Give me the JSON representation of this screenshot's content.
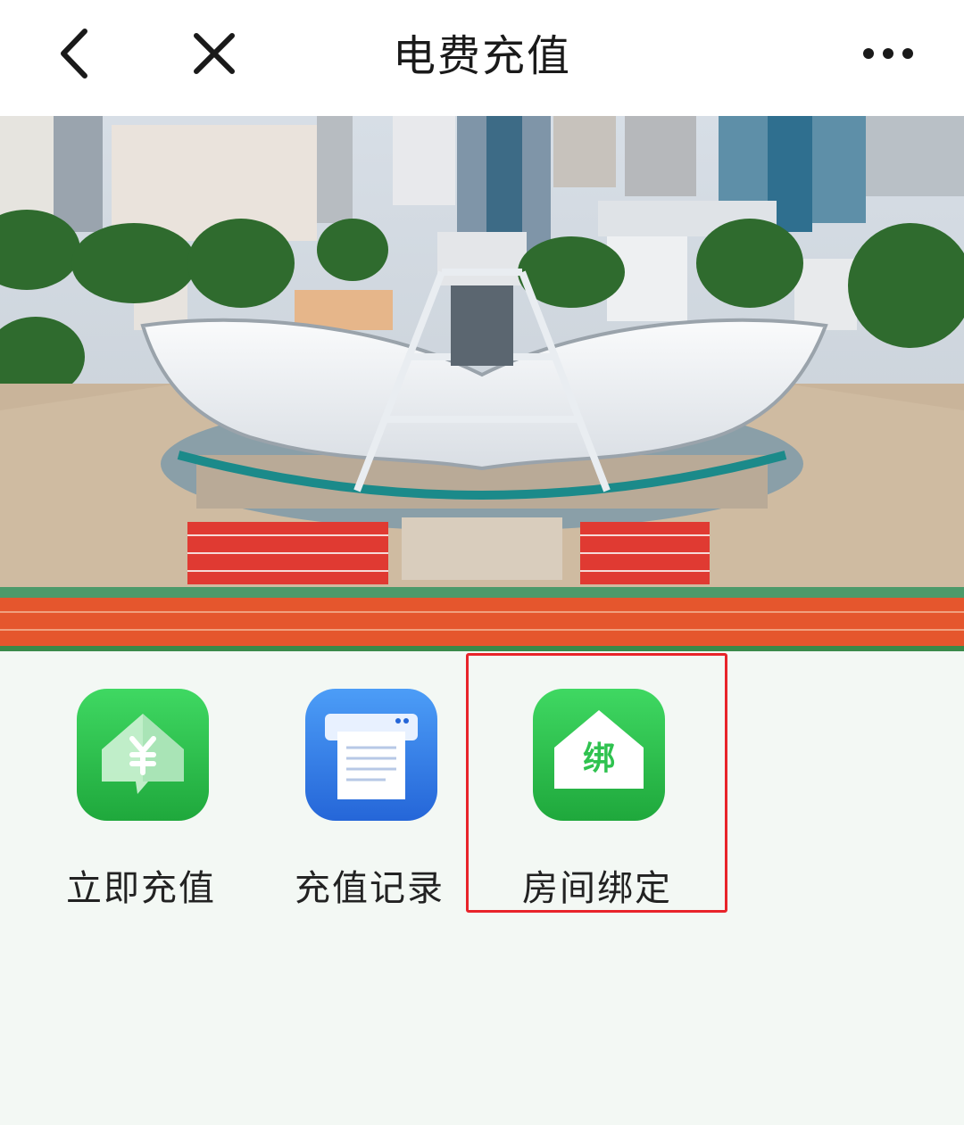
{
  "navbar": {
    "title": "电费充值",
    "back_icon": "chevron-left-icon",
    "close_icon": "close-icon",
    "more_icon": "more-horizontal-icon"
  },
  "banner": {
    "description": "campus-stadium-photo"
  },
  "actions": [
    {
      "label": "立即充值",
      "icon": "recharge-house-yuan-icon",
      "color": "#2fc24f"
    },
    {
      "label": "充值记录",
      "icon": "receipt-printer-icon",
      "color": "#2f7df0"
    },
    {
      "label": "房间绑定",
      "icon": "bind-house-icon",
      "color": "#2fc24f",
      "icon_text": "绑"
    }
  ],
  "highlight_color": "#e8242a"
}
